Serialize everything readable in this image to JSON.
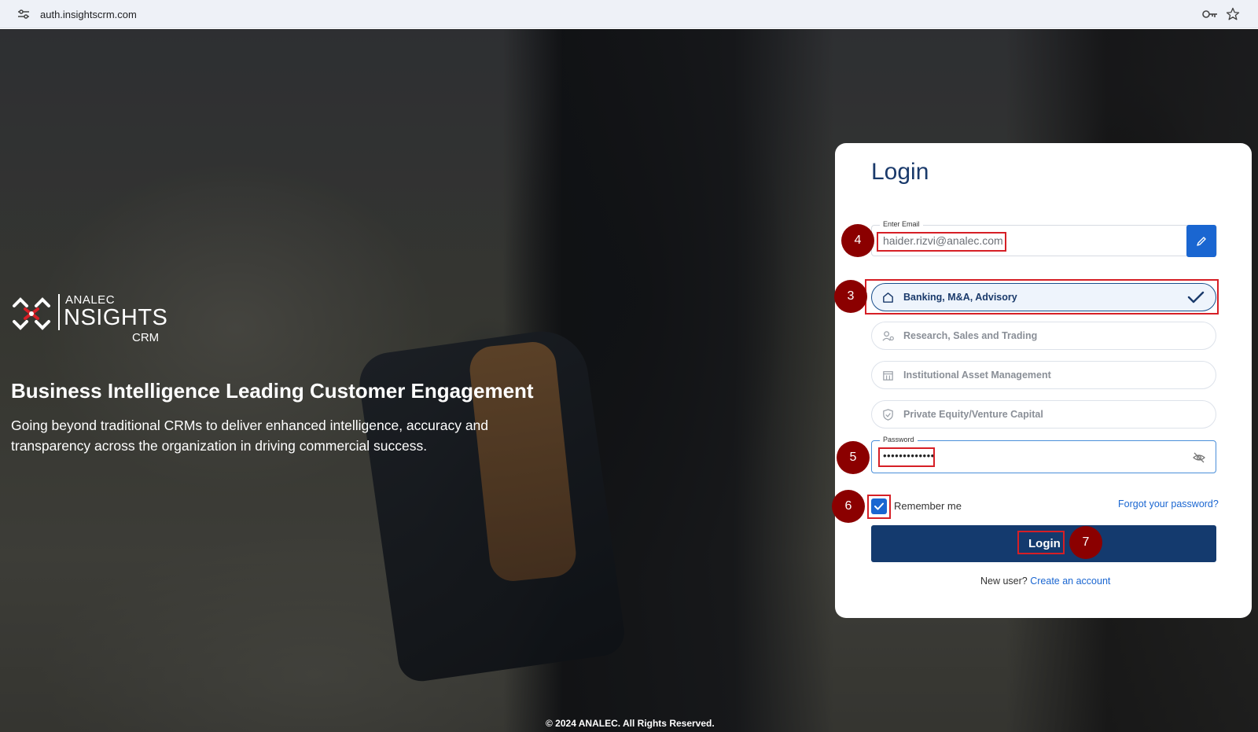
{
  "browser": {
    "url": "auth.insightscrm.com"
  },
  "brand": {
    "top": "ANALEC",
    "main": "NSIGHTS",
    "sub": "CRM"
  },
  "hero": {
    "title": "Business Intelligence Leading Customer Engagement",
    "description": "Going beyond traditional CRMs to deliver enhanced intelligence, accuracy and transparency across the organization in driving commercial success."
  },
  "login": {
    "title": "Login",
    "email_label": "Enter Email",
    "email_value": "haider.rizvi@analec.com",
    "options": [
      {
        "label": "Banking, M&A, Advisory",
        "icon": "home-icon",
        "selected": true
      },
      {
        "label": "Research, Sales and Trading",
        "icon": "users-gear-icon",
        "selected": false
      },
      {
        "label": "Institutional Asset Management",
        "icon": "building-icon",
        "selected": false
      },
      {
        "label": "Private Equity/Venture Capital",
        "icon": "shield-icon",
        "selected": false
      }
    ],
    "password_label": "Password",
    "password_value": "•••••••••••••",
    "remember_label": "Remember me",
    "remember_checked": true,
    "forgot_label": "Forgot your password?",
    "submit_label": "Login",
    "new_user_text": "New user?",
    "create_account_label": "Create an account"
  },
  "annotations": [
    "4",
    "3",
    "5",
    "6",
    "7"
  ],
  "footer": "© 2024 ANALEC. All Rights Reserved.",
  "colors": {
    "primary": "#143a6e",
    "accent": "#1a66d1",
    "annotation": "#8b0000",
    "highlight": "#d61f26"
  }
}
